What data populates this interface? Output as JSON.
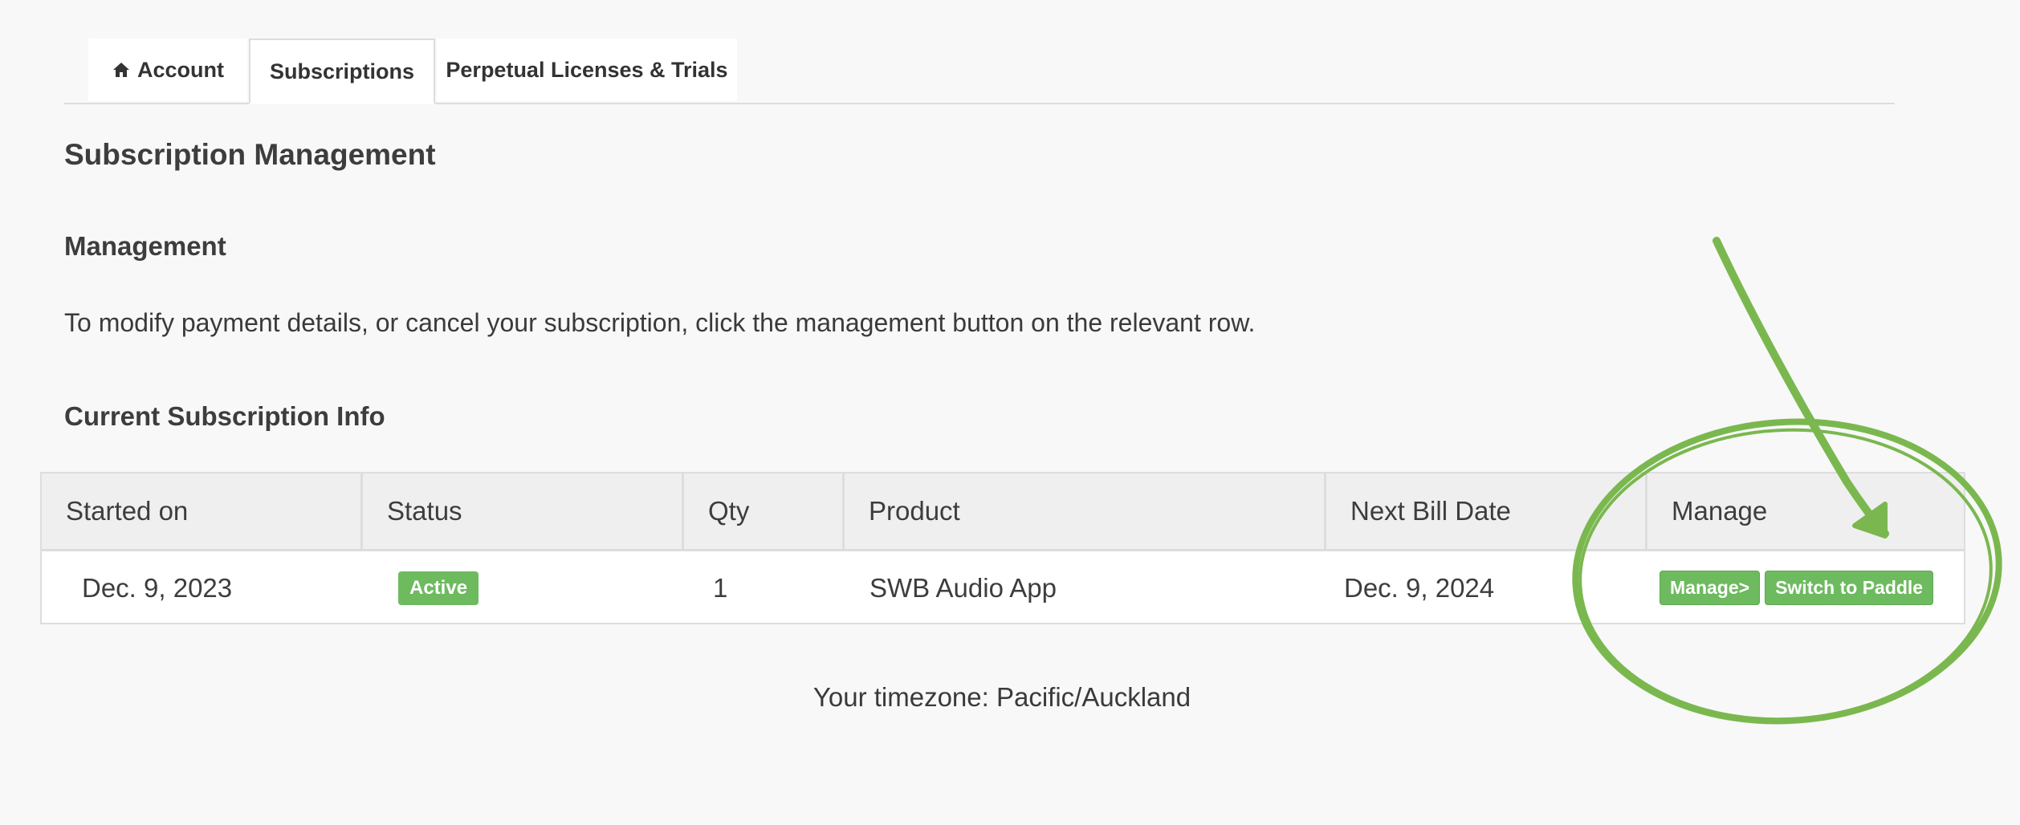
{
  "tabs": {
    "account_label": "Account",
    "subscriptions_label": "Subscriptions",
    "perpetual_label": "Perpetual Licenses & Trials",
    "active_tab": "Subscriptions"
  },
  "page_title": "Subscription Management",
  "management": {
    "heading": "Management",
    "description": "To modify payment details, or cancel your subscription, click the management button on the relevant row."
  },
  "info": {
    "heading": "Current Subscription Info",
    "columns": [
      "Started on",
      "Status",
      "Qty",
      "Product",
      "Next Bill Date",
      "Manage"
    ],
    "row": {
      "started_on": "Dec. 9, 2023",
      "status": "Active",
      "qty": "1",
      "product": "SWB Audio App",
      "next_bill_date": "Dec. 9, 2024",
      "manage_label": "Manage>",
      "switch_label": "Switch to Paddle"
    }
  },
  "timezone_text": "Your timezone: Pacific/Auckland",
  "colors": {
    "accent_green": "#6dba5f",
    "annotation_green": "#7ab84f"
  }
}
